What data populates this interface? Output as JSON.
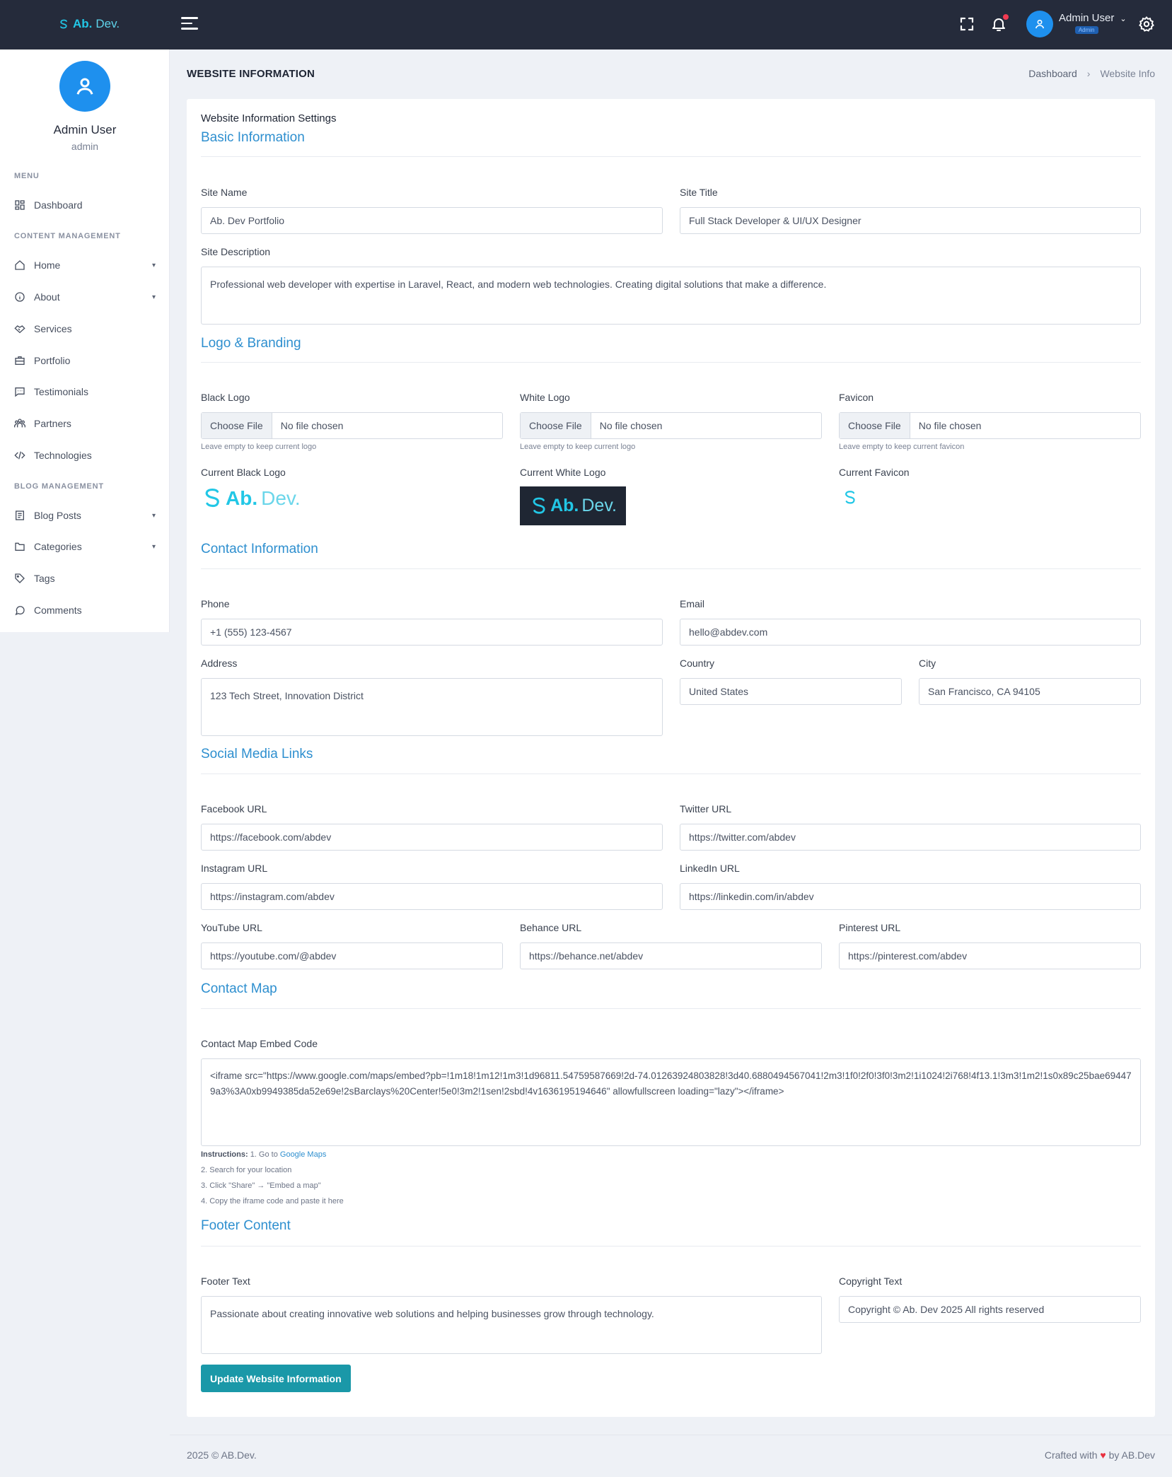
{
  "topbar": {
    "brand_main": "Ab.",
    "brand_sub": "Dev.",
    "user_name": "Admin User",
    "user_role": "Admin"
  },
  "sidebar": {
    "profile_name": "Admin User",
    "profile_role": "admin",
    "heading_menu": "MENU",
    "heading_content": "CONTENT MANAGEMENT",
    "heading_blog": "BLOG MANAGEMENT",
    "items": [
      {
        "label": "Dashboard",
        "icon": "dashboard-icon"
      },
      {
        "label": "Home",
        "icon": "home-icon",
        "has_children": true
      },
      {
        "label": "About",
        "icon": "info-icon",
        "has_children": true
      },
      {
        "label": "Services",
        "icon": "handshake-icon"
      },
      {
        "label": "Portfolio",
        "icon": "briefcase-icon"
      },
      {
        "label": "Testimonials",
        "icon": "message-square-icon"
      },
      {
        "label": "Partners",
        "icon": "users-icon"
      },
      {
        "label": "Technologies",
        "icon": "code-icon"
      },
      {
        "label": "Blog Posts",
        "icon": "document-icon",
        "has_children": true
      },
      {
        "label": "Categories",
        "icon": "folder-icon",
        "has_children": true
      },
      {
        "label": "Tags",
        "icon": "tag-icon"
      },
      {
        "label": "Comments",
        "icon": "chat-bubble-icon"
      }
    ]
  },
  "page": {
    "title": "WEBSITE INFORMATION",
    "breadcrumb": [
      "Dashboard",
      "Website Info"
    ],
    "breadcrumb_sep": "›"
  },
  "form": {
    "card_title": "Website Information Settings",
    "sections": {
      "basic": "Basic Information",
      "logo": "Logo & Branding",
      "contact": "Contact Information",
      "social": "Social Media Links",
      "map": "Contact Map",
      "footer": "Footer Content"
    },
    "site_name": {
      "label": "Site Name",
      "value": "Ab. Dev Portfolio"
    },
    "site_title": {
      "label": "Site Title",
      "value": "Full Stack Developer & UI/UX Designer"
    },
    "site_description": {
      "label": "Site Description",
      "value": "Professional web developer with expertise in Laravel, React, and modern web technologies. Creating digital solutions that make a difference."
    },
    "black_logo": {
      "label": "Black Logo",
      "button": "Choose File",
      "status": "No file chosen",
      "hint": "Leave empty to keep current logo",
      "current_label": "Current Black Logo"
    },
    "white_logo": {
      "label": "White Logo",
      "button": "Choose File",
      "status": "No file chosen",
      "hint": "Leave empty to keep current logo",
      "current_label": "Current White Logo"
    },
    "favicon": {
      "label": "Favicon",
      "button": "Choose File",
      "status": "No file chosen",
      "hint": "Leave empty to keep current favicon",
      "current_label": "Current Favicon"
    },
    "phone": {
      "label": "Phone",
      "value": "+1 (555) 123-4567"
    },
    "email": {
      "label": "Email",
      "value": "hello@abdev.com"
    },
    "address": {
      "label": "Address",
      "value": "123 Tech Street, Innovation District"
    },
    "country": {
      "label": "Country",
      "value": "United States"
    },
    "city": {
      "label": "City",
      "value": "San Francisco, CA 94105"
    },
    "facebook": {
      "label": "Facebook URL",
      "value": "https://facebook.com/abdev"
    },
    "twitter": {
      "label": "Twitter URL",
      "value": "https://twitter.com/abdev"
    },
    "instagram": {
      "label": "Instagram URL",
      "value": "https://instagram.com/abdev"
    },
    "linkedin": {
      "label": "LinkedIn URL",
      "value": "https://linkedin.com/in/abdev"
    },
    "youtube": {
      "label": "YouTube URL",
      "value": "https://youtube.com/@abdev"
    },
    "behance": {
      "label": "Behance URL",
      "value": "https://behance.net/abdev"
    },
    "pinterest": {
      "label": "Pinterest URL",
      "value": "https://pinterest.com/abdev"
    },
    "map_embed": {
      "label": "Contact Map Embed Code",
      "value": "<iframe src=\"https://www.google.com/maps/embed?pb=!1m18!1m12!1m3!1d96811.54759587669!2d-74.01263924803828!3d40.6880494567041!2m3!1f0!2f0!3f0!3m2!1i1024!2i768!4f13.1!3m3!1m2!1s0x89c25bae694479a3%3A0xb9949385da52e69e!2sBarclays%20Center!5e0!3m2!1sen!2sbd!4v1636195194646\" allowfullscreen loading=\"lazy\"></iframe>",
      "instr_label": "Instructions:",
      "instr_1": "1. Go to",
      "instr_1_link": "Google Maps",
      "instr_2": "2. Search for your location",
      "instr_3": "3. Click \"Share\" → \"Embed a map\"",
      "instr_4": "4. Copy the iframe code and paste it here"
    },
    "footer_text": {
      "label": "Footer Text",
      "value": "Passionate about creating innovative web solutions and helping businesses grow through technology."
    },
    "copyright": {
      "label": "Copyright Text",
      "value": "Copyright © Ab. Dev 2025 All rights reserved"
    },
    "submit_label": "Update Website Information"
  },
  "footer": {
    "left": "2025 © AB.Dev.",
    "right_prefix": "Crafted with",
    "heart": "♥",
    "right_suffix": "by AB.Dev"
  },
  "colors": {
    "topbar_bg": "#252b3b",
    "accent_blue": "#1e90ee",
    "section_title": "#2e8fcf",
    "submit_button": "#1a98a8",
    "brand_cyan": "#22c7e6"
  }
}
